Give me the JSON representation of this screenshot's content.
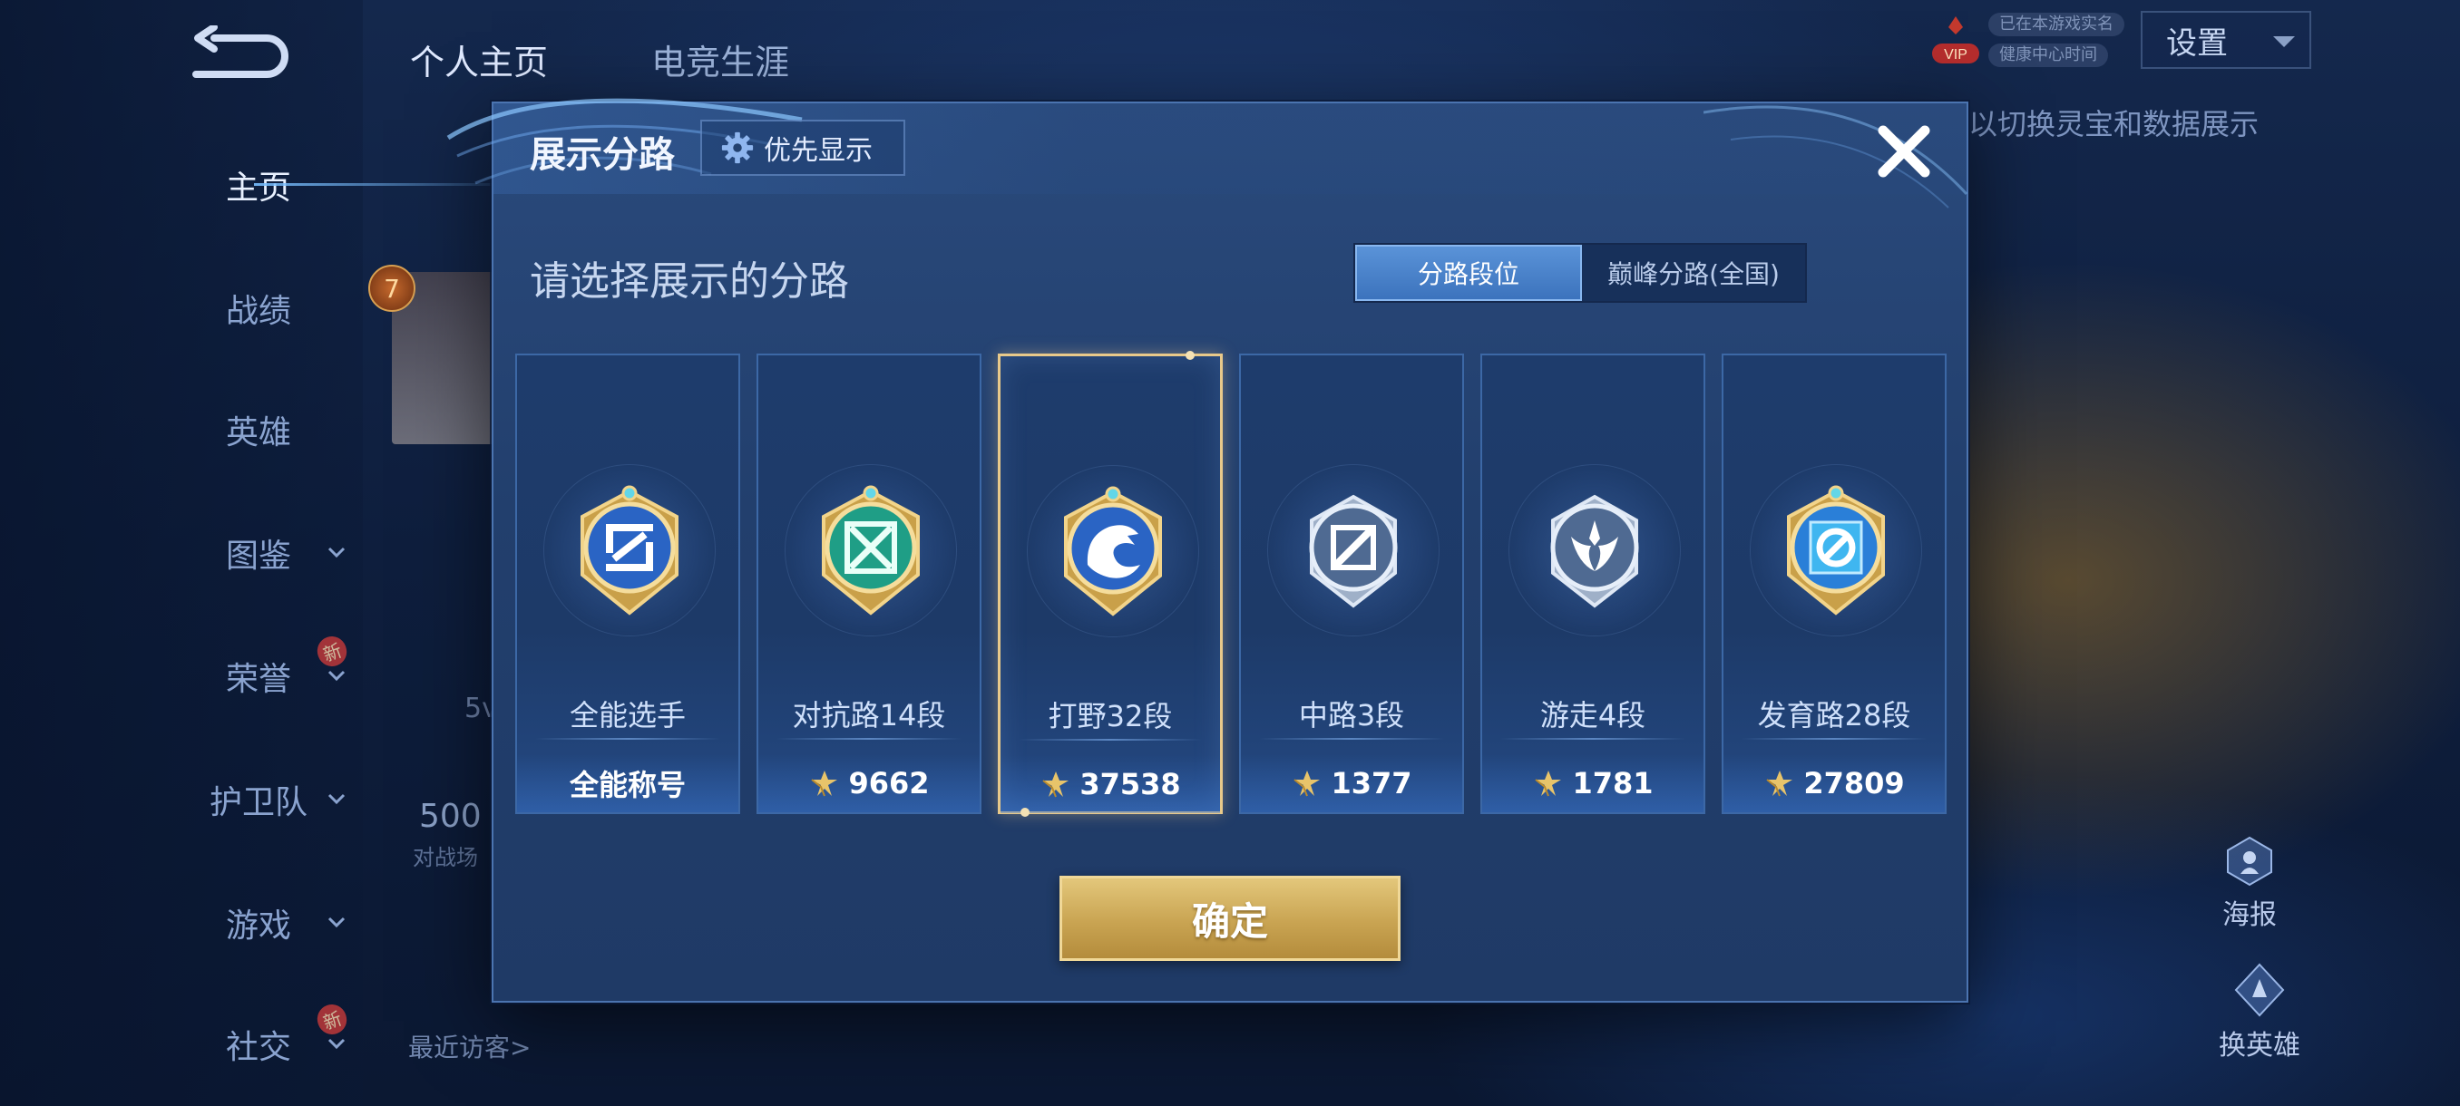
{
  "background": {
    "top_tabs": [
      "个人主页",
      "电竞生涯"
    ],
    "settings_label": "设置",
    "vip_label": "VIP",
    "status_lines": [
      "已在本游戏实名",
      "健康中心时间"
    ],
    "hint_text": "以切换灵宝和数据展示",
    "poster_label": "海报",
    "switch_hero_label": "换英雄",
    "recent_visitors": "最近访客>",
    "level": "7",
    "stat_value": "500",
    "stat_caption": "对战场",
    "mode_text": "5v",
    "new_badge": "新"
  },
  "sidebar": {
    "items": [
      {
        "label": "主页",
        "active": true,
        "chevron": false
      },
      {
        "label": "战绩",
        "active": false,
        "chevron": false
      },
      {
        "label": "英雄",
        "active": false,
        "chevron": false
      },
      {
        "label": "图鉴",
        "active": false,
        "chevron": true
      },
      {
        "label": "荣誉",
        "active": false,
        "chevron": true,
        "badge": "新"
      },
      {
        "label": "护卫队",
        "active": false,
        "chevron": true
      },
      {
        "label": "游戏",
        "active": false,
        "chevron": true
      },
      {
        "label": "社交",
        "active": false,
        "chevron": true,
        "badge": "新"
      }
    ]
  },
  "modal": {
    "title": "展示分路",
    "priority_button": "优先显示",
    "subtitle": "请选择展示的分路",
    "segments": [
      {
        "label": "分路段位",
        "selected": true
      },
      {
        "label": "巅峰分路(全国)",
        "selected": false
      }
    ],
    "cards": [
      {
        "lane": "全能选手",
        "value": "全能称号",
        "icon": "all-round-badge-icon",
        "show_points_icon": false,
        "selected": false
      },
      {
        "lane": "对抗路14段",
        "value": "9662",
        "icon": "clash-lane-badge-icon",
        "show_points_icon": true,
        "selected": false
      },
      {
        "lane": "打野32段",
        "value": "37538",
        "icon": "jungle-badge-icon",
        "show_points_icon": true,
        "selected": true
      },
      {
        "lane": "中路3段",
        "value": "1377",
        "icon": "mid-lane-badge-icon",
        "show_points_icon": true,
        "selected": false
      },
      {
        "lane": "游走4段",
        "value": "1781",
        "icon": "roam-badge-icon",
        "show_points_icon": true,
        "selected": false
      },
      {
        "lane": "发育路28段",
        "value": "27809",
        "icon": "farm-lane-badge-icon",
        "show_points_icon": true,
        "selected": false
      }
    ],
    "confirm_button": "确定"
  },
  "colors": {
    "gold": "#e3c77b",
    "modal_bg": "#223f6d",
    "accent_blue": "#4b8ad6"
  }
}
